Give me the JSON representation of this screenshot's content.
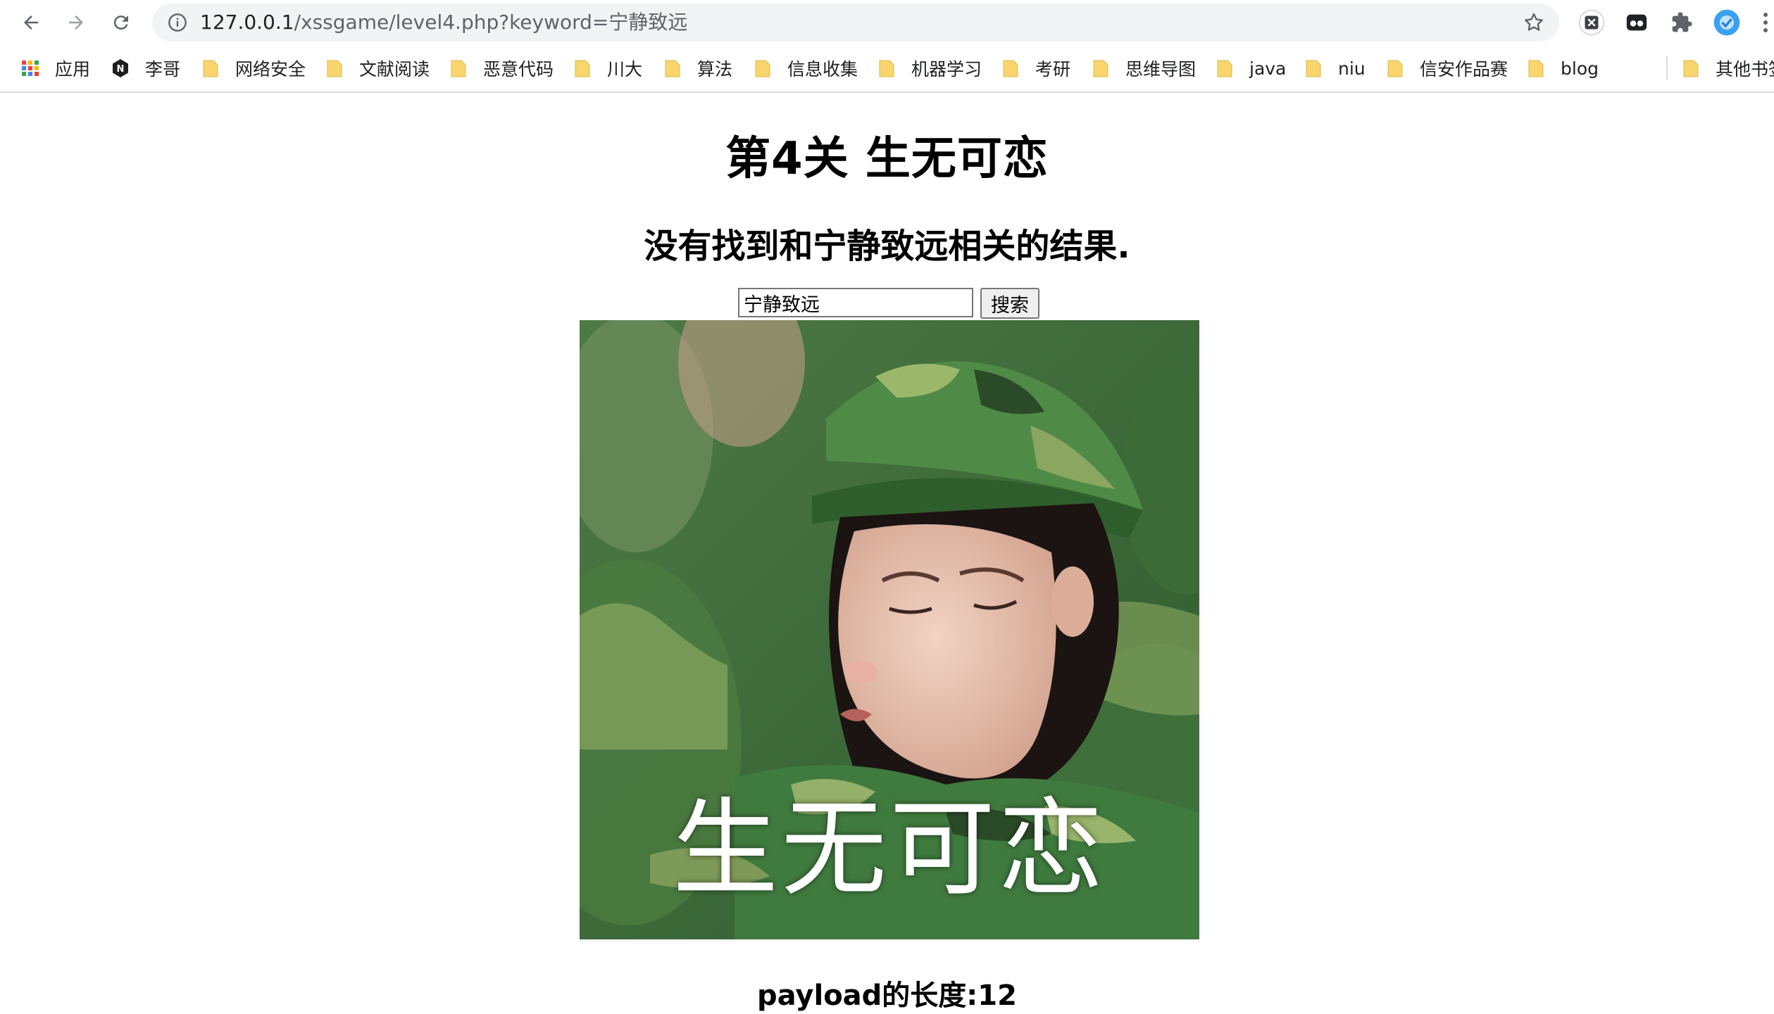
{
  "browser": {
    "url_host": "127.0.0.1",
    "url_rest": "/xssgame/level4.php?keyword=宁静致远",
    "bookmarks": [
      {
        "label": "应用",
        "icon": "apps-grid-icon"
      },
      {
        "label": "李哥",
        "icon": "n-logo-icon"
      },
      {
        "label": "网络安全",
        "icon": "folder-icon"
      },
      {
        "label": "文献阅读",
        "icon": "folder-icon"
      },
      {
        "label": "恶意代码",
        "icon": "folder-icon"
      },
      {
        "label": "川大",
        "icon": "folder-icon"
      },
      {
        "label": "算法",
        "icon": "folder-icon"
      },
      {
        "label": "信息收集",
        "icon": "folder-icon"
      },
      {
        "label": "机器学习",
        "icon": "folder-icon"
      },
      {
        "label": "考研",
        "icon": "folder-icon"
      },
      {
        "label": "思维导图",
        "icon": "folder-icon"
      },
      {
        "label": "java",
        "icon": "folder-icon"
      },
      {
        "label": "niu",
        "icon": "folder-icon"
      },
      {
        "label": "信安作品赛",
        "icon": "folder-icon"
      },
      {
        "label": "blog",
        "icon": "folder-icon"
      },
      {
        "label": "其他书签",
        "icon": "folder-icon"
      }
    ]
  },
  "page": {
    "title": "第4关 生无可恋",
    "result_text": "没有找到和宁静致远相关的结果.",
    "search_value": "宁静致远",
    "search_button": "搜索",
    "image_caption": "生无可恋",
    "payload_text": "payload的长度:12"
  },
  "colors": {
    "folder": "#f9d56e",
    "camo_light": "#7ba35a",
    "camo_dark": "#2f5a2c"
  }
}
